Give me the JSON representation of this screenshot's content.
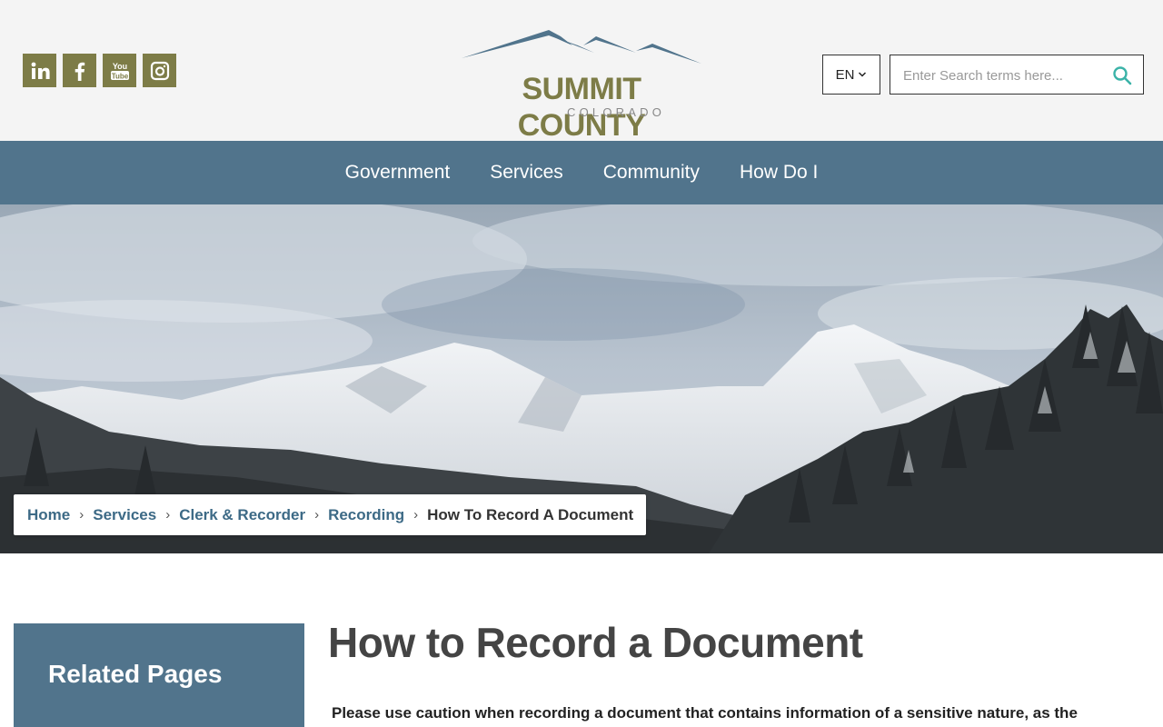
{
  "header": {
    "social": [
      {
        "name": "linkedin",
        "icon": "linkedin-icon"
      },
      {
        "name": "facebook",
        "icon": "facebook-icon"
      },
      {
        "name": "youtube",
        "icon": "youtube-icon"
      },
      {
        "name": "instagram",
        "icon": "instagram-icon"
      }
    ],
    "logo": {
      "name": "SUMMIT COUNTY",
      "sub": "COLORADO"
    },
    "language": "EN",
    "search": {
      "placeholder": "Enter Search terms here..."
    }
  },
  "nav": {
    "items": [
      "Government",
      "Services",
      "Community",
      "How Do I"
    ]
  },
  "breadcrumb": {
    "items": [
      "Home",
      "Services",
      "Clerk & Recorder",
      "Recording"
    ],
    "current": "How To Record A Document"
  },
  "sidebar": {
    "title": "Related Pages"
  },
  "main": {
    "title": "How to Record a Document",
    "intro": "Please use caution when recording a document that contains information of a sensitive nature, as the"
  },
  "colors": {
    "accent_olive": "#7d7c47",
    "nav_blue": "#51748c",
    "search_teal": "#3bb3a8"
  },
  "youtube_text": {
    "top": "You",
    "bottom": "Tube"
  }
}
